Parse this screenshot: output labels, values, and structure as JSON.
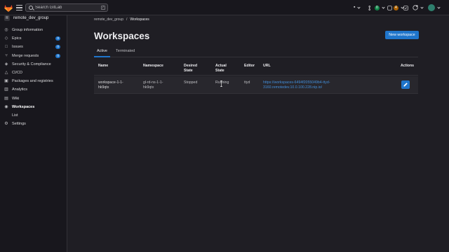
{
  "topbar": {
    "search_placeholder": "Search GitLab",
    "search_shortcut": "/",
    "merge_requests_count": "0",
    "todos_count": "4"
  },
  "sidebar": {
    "group_initial": "R",
    "group_name": "remote_dev_group",
    "items": [
      {
        "label": "Group information",
        "icon": "group-icon"
      },
      {
        "label": "Epics",
        "icon": "epic-icon",
        "count": "0"
      },
      {
        "label": "Issues",
        "icon": "issues-icon",
        "count": "0"
      },
      {
        "label": "Merge requests",
        "icon": "merge-request-icon",
        "count": "0"
      },
      {
        "label": "Security & Compliance",
        "icon": "shield-icon"
      },
      {
        "label": "CI/CD",
        "icon": "rocket-icon"
      },
      {
        "label": "Packages and registries",
        "icon": "package-icon"
      },
      {
        "label": "Analytics",
        "icon": "chart-icon"
      },
      {
        "label": "Wiki",
        "icon": "book-icon"
      },
      {
        "label": "Workspaces",
        "icon": "cloud-terminal-icon",
        "active": true
      }
    ],
    "sub_item": "List",
    "settings_label": "Settings"
  },
  "breadcrumb": {
    "group": "remote_dev_group",
    "separator": "/",
    "current": "Workspaces"
  },
  "page": {
    "title": "Workspaces",
    "new_button": "New workspace"
  },
  "tabs": [
    {
      "label": "Active",
      "active": true
    },
    {
      "label": "Terminated",
      "active": false
    }
  ],
  "table": {
    "headers": {
      "name": "Name",
      "namespace": "Namespace",
      "desired_state_1": "Desired",
      "desired_state_2": "State",
      "actual_state_1": "Actual",
      "actual_state_2": "State",
      "editor": "Editor",
      "url": "URL",
      "actions": "Actions"
    },
    "row": {
      "name_1": "workspace-1-1-",
      "name_2": "hk9qtx",
      "namespace_1": "gl-rd-ns-1-1-",
      "namespace_2": "hk9qtx",
      "desired_state": "Stopped",
      "actual_state": "Running",
      "editor": "ttyd",
      "url_1": "https://workspaces-6494f2055049b4-ttyd-",
      "url_2": "3160.remotedev.10.0.100.228.nip.io/"
    }
  },
  "colors": {
    "accent": "#1f75cb",
    "link": "#428fdc",
    "background": "#1f1e24",
    "sidebar": "#18171d"
  }
}
